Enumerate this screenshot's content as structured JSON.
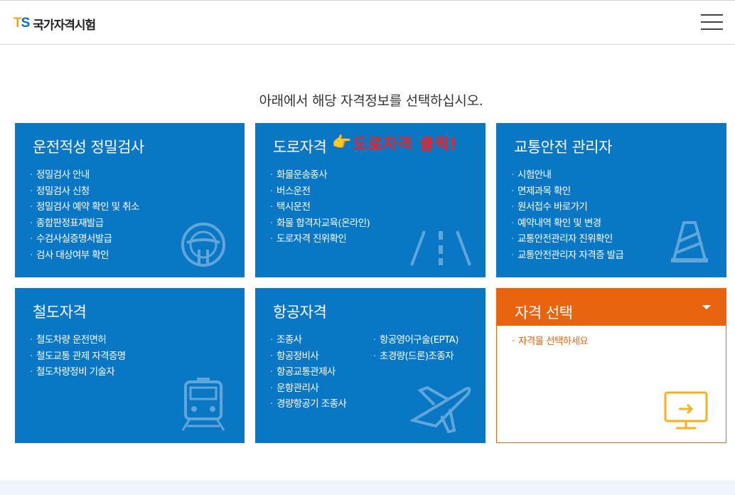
{
  "header": {
    "logo_mark_t": "T",
    "logo_mark_s": "S",
    "logo_text": "국가자격시험",
    "menu_icon": "hamburger-menu-icon"
  },
  "heading": "아래에서 해당 자격정보를 선택하십시오.",
  "cards": [
    {
      "title": "운전적성 정밀검사",
      "icon": "steering-wheel-icon",
      "items": [
        "정밀검사 안내",
        "정밀검사 신청",
        "정밀검사 예약 확인 및 취소",
        "종합판정표재발급",
        "수검사실증명서발급",
        "검사 대상여부 확인"
      ]
    },
    {
      "title": "도로자격",
      "icon": "road-icon",
      "items": [
        "화물운송종사",
        "버스운전",
        "택시운전",
        "화물 합격자교육(온라인)",
        "도로자격 진위확인"
      ]
    },
    {
      "title": "교통안전 관리자",
      "icon": "traffic-cone-icon",
      "items": [
        "시험안내",
        "면제과목 확인",
        "원서접수 바로가기",
        "예약내역 확인 및 변경",
        "교통안전관리자 진위확인",
        "교통안전관리자 자격증 발급"
      ]
    },
    {
      "title": "철도자격",
      "icon": "train-icon",
      "items": [
        "철도차량 운전면허",
        "철도교통 관제 자격증명",
        "철도차량정비 기술자"
      ]
    },
    {
      "title": "항공자격",
      "icon": "airplane-icon",
      "items_col1": [
        "조종사",
        "항공정비사",
        "항공교통관제사",
        "운항관리사",
        "경량항공기 조종사"
      ],
      "items_col2": [
        "항공영어구술(EPTA)",
        "초경량(드론)조종자"
      ]
    }
  ],
  "annotation": {
    "hand_icon": "pointing-hand-icon",
    "text": "도로자격 클릭!"
  },
  "select": {
    "label": "자격 선택",
    "arrow_icon": "caret-down-icon",
    "hint": "자격을 선택하세요",
    "monitor_icon": "monitor-arrow-icon"
  },
  "colors": {
    "card_blue": "#0a77c5",
    "select_orange": "#e8640f",
    "annotation_red": "#ff1a1a",
    "logo_t": "#f5a31a",
    "logo_s": "#0a6dc2"
  }
}
